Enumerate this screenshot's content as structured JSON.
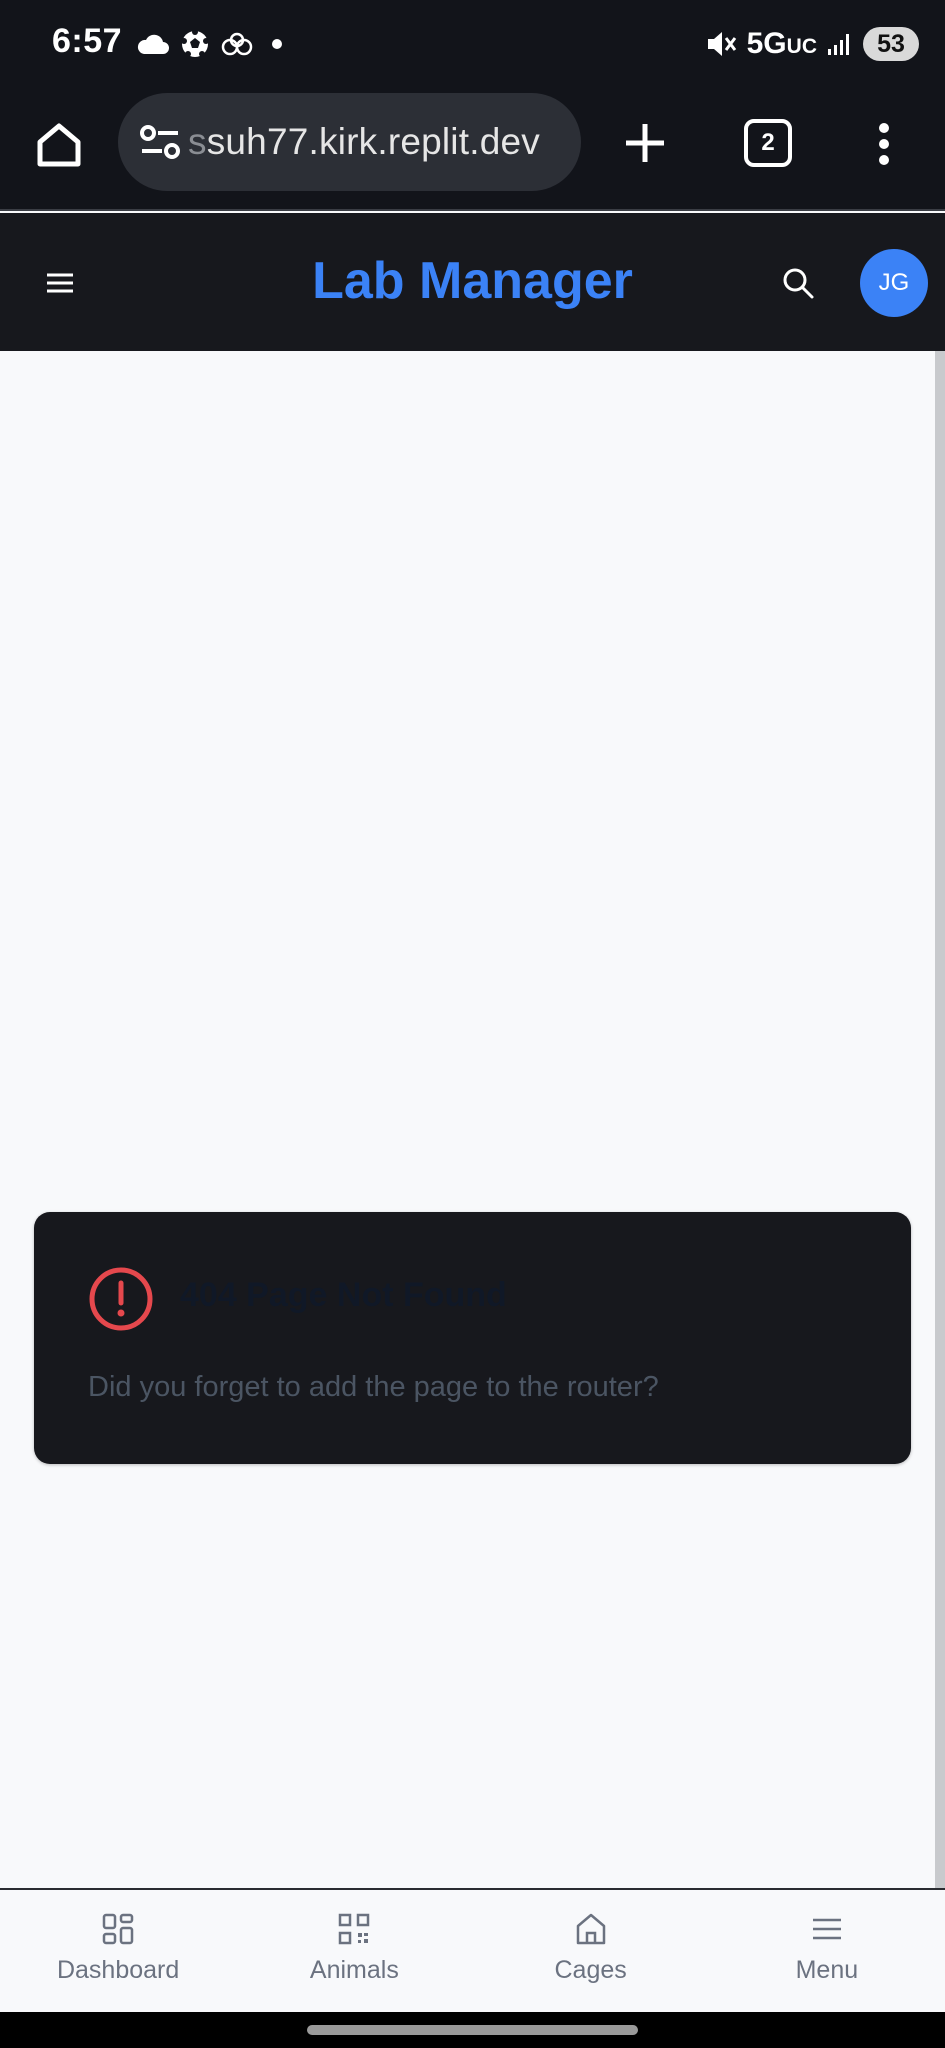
{
  "status_bar": {
    "time": "6:57",
    "network": "5G",
    "network_sub": "UC",
    "battery": "53",
    "icons": [
      "cloud-icon",
      "soccer-ball-icon",
      "cloud-sync-icon",
      "dot-icon",
      "mute-icon",
      "signal-icon"
    ]
  },
  "browser": {
    "url_prefix": "s",
    "url": "suh77.kirk.replit.dev",
    "tab_count": "2"
  },
  "header": {
    "title": "Lab Manager",
    "avatar_initials": "JG"
  },
  "error": {
    "title": "404 Page Not Found",
    "message": "Did you forget to add the page to the router?"
  },
  "bottom_nav": {
    "items": [
      {
        "label": "Dashboard",
        "icon": "dashboard-icon"
      },
      {
        "label": "Animals",
        "icon": "qr-code-icon"
      },
      {
        "label": "Cages",
        "icon": "home-icon"
      },
      {
        "label": "Menu",
        "icon": "menu-icon"
      }
    ]
  },
  "colors": {
    "accent": "#3b82f6",
    "error": "#e5484d",
    "header_bg": "#17181d",
    "page_bg": "#f8f9fb"
  }
}
